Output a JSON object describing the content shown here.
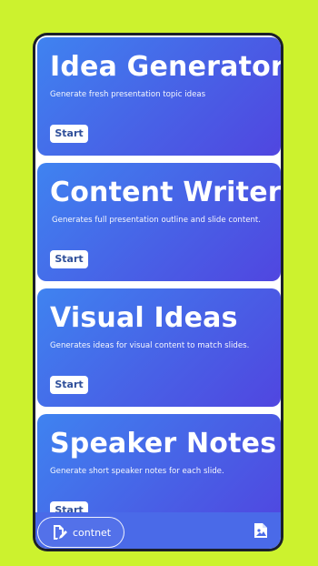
{
  "cards": [
    {
      "title": "Idea Generator",
      "description": "Generate fresh presentation topic ideas",
      "button_label": "Start"
    },
    {
      "title": "Content Writer",
      "description": "Generates full presentation outline and slide content.",
      "button_label": "Start"
    },
    {
      "title": "Visual Ideas",
      "description": "Generates ideas for visual content  to match slides.",
      "button_label": "Start"
    },
    {
      "title": "Speaker Notes",
      "description": "Generate short speaker notes for each slide.",
      "button_label": "Start"
    }
  ],
  "bottom_nav": {
    "active_label": "contnet",
    "active_icon": "edit-document-icon",
    "right_icon": "image-document-icon"
  },
  "colors": {
    "background": "#ccf22e",
    "card_gradient_start": "#3f83f0",
    "card_gradient_end": "#5046e0",
    "button_text": "#2f4f9a"
  }
}
